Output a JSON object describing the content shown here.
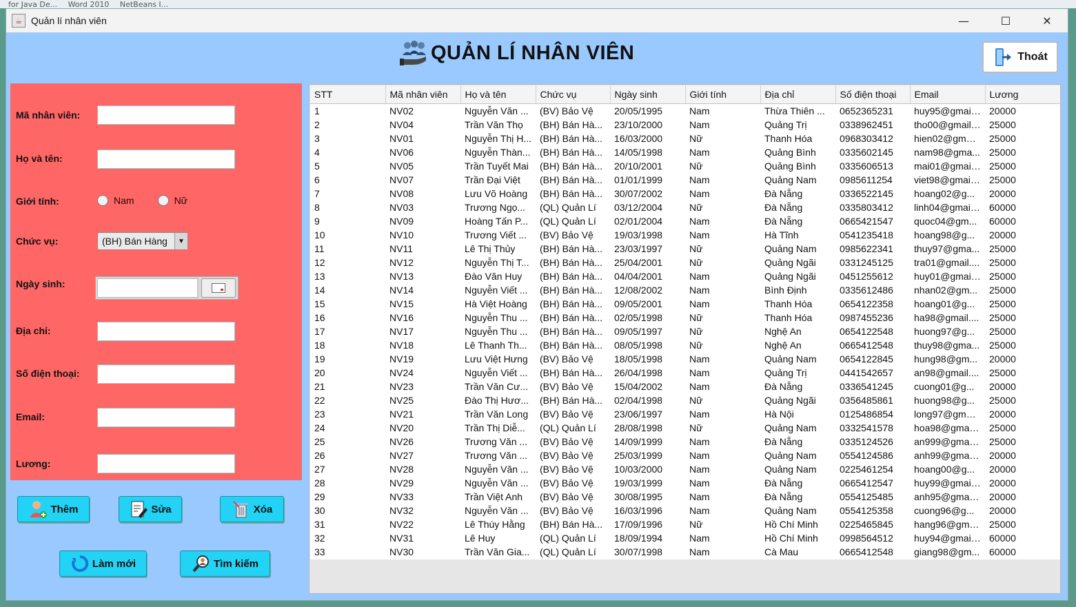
{
  "taskbar": [
    "for Java De...",
    "Word 2010",
    "NetBeans I..."
  ],
  "window": {
    "title": "Quản lí nhân viên",
    "controls": {
      "minimize": "—",
      "maximize": "☐",
      "close": "✕"
    }
  },
  "header": {
    "title": "QUẢN LÍ NHÂN VIÊN",
    "exit_label": "Thoát"
  },
  "form": {
    "labels": {
      "ma_nv": "Mã nhân viên:",
      "ho_ten": "Họ và tên:",
      "gioi_tinh": "Giới tính:",
      "chuc_vu": "Chức vụ:",
      "ngay_sinh": "Ngày sinh:",
      "dia_chi": "Địa chỉ:",
      "sdt": "Số điện thoại:",
      "email": "Email:",
      "luong": "Lương:"
    },
    "values": {
      "ma_nv": "",
      "ho_ten": "",
      "ngay_sinh": "",
      "dia_chi": "",
      "sdt": "",
      "email": "",
      "luong": ""
    },
    "gender_options": [
      "Nam",
      "Nữ"
    ],
    "chuc_vu_selected": "(BH) Bán Hàng"
  },
  "buttons": {
    "them": "Thêm",
    "sua": "Sửa",
    "xoa": "Xóa",
    "lam_moi": "Làm mới",
    "tim_kiem": "Tìm kiếm"
  },
  "colors": {
    "window_bg": "#99c9ff",
    "form_bg": "#ff6666",
    "button_bg": "#22d3f5"
  },
  "table": {
    "columns": [
      "STT",
      "Mã nhân viên",
      "Họ và tên",
      "Chức vụ",
      "Ngày sinh",
      "Giới tính",
      "Địa chỉ",
      "Số điện thoại",
      "Email",
      "Lương"
    ],
    "rows": [
      [
        "1",
        "NV02",
        "Nguyễn Văn ...",
        "(BV) Bảo Vệ",
        "20/05/1995",
        "Nam",
        "Thừa Thiên ...",
        "0652365231",
        "huy95@gmail....",
        "20000"
      ],
      [
        "2",
        "NV04",
        "Trần Văn Thọ",
        "(BH) Bán Hà...",
        "23/10/2000",
        "Nam",
        "Quảng Trị",
        "0338962451",
        "tho00@gmail....",
        "25000"
      ],
      [
        "3",
        "NV01",
        "Nguyễn Thị H...",
        "(BH) Bán Hà...",
        "16/03/2000",
        "Nữ",
        "Thanh Hóa",
        "0968303412",
        "hien02@gmai...",
        "25000"
      ],
      [
        "4",
        "NV06",
        "Nguyễn Thàn...",
        "(BH) Bán Hà...",
        "14/05/1998",
        "Nam",
        "Quảng Bình",
        "0335602145",
        "nam98@gma...",
        "25000"
      ],
      [
        "5",
        "NV05",
        "Trần Tuyết Mai",
        "(BH) Bán Hà...",
        "20/10/2001",
        "Nữ",
        "Quảng Bình",
        "0335606513",
        "mai01@gmail....",
        "25000"
      ],
      [
        "6",
        "NV07",
        "Trần Đại Việt",
        "(BH) Bán Hà...",
        "01/01/1999",
        "Nam",
        "Quảng Nam",
        "0985611254",
        "viet98@gmail....",
        "25000"
      ],
      [
        "7",
        "NV08",
        "Lưu Võ Hoàng",
        "(BH) Bán Hà...",
        "30/07/2002",
        "Nam",
        "Đà Nẵng",
        "0336522145",
        "hoang02@g...",
        "20000"
      ],
      [
        "8",
        "NV03",
        "Trương Ngọ...",
        "(QL) Quản Lí",
        "03/12/2004",
        "Nữ",
        "Đà Nẵng",
        "0335803412",
        "linh04@gmail....",
        "60000"
      ],
      [
        "9",
        "NV09",
        "Hoàng Tấn P...",
        "(QL) Quản Lí",
        "02/01/2004",
        "Nam",
        "Đà Nẵng",
        "0665421547",
        "quoc04@gm...",
        "60000"
      ],
      [
        "10",
        "NV10",
        "Trương Viết ...",
        "(BV) Bảo Vệ",
        "19/03/1998",
        "Nam",
        "Hà Tĩnh",
        "0541235418",
        "hoang98@g...",
        "20000"
      ],
      [
        "11",
        "NV11",
        "Lê Thị Thủy",
        "(BH) Bán Hà...",
        "23/03/1997",
        "Nữ",
        "Quảng Nam",
        "0985622341",
        "thuy97@gma...",
        "25000"
      ],
      [
        "12",
        "NV12",
        "Nguyễn Thị T...",
        "(BH) Bán Hà...",
        "25/04/2001",
        "Nữ",
        "Quảng Ngãi",
        "0331245125",
        "tra01@gmail....",
        "25000"
      ],
      [
        "13",
        "NV13",
        "Đào Văn Huy",
        "(BH) Bán Hà...",
        "04/04/2001",
        "Nam",
        "Quảng Ngãi",
        "0451255612",
        "huy01@gmail....",
        "25000"
      ],
      [
        "14",
        "NV14",
        "Nguyễn Viết ...",
        "(BH) Bán Hà...",
        "12/08/2002",
        "Nam",
        "Bình Định",
        "0335612486",
        "nhan02@gm...",
        "25000"
      ],
      [
        "15",
        "NV15",
        "Hà Việt Hoàng",
        "(BH) Bán Hà...",
        "09/05/2001",
        "Nam",
        "Thanh Hóa",
        "0654122358",
        "hoang01@g...",
        "25000"
      ],
      [
        "16",
        "NV16",
        "Nguyễn Thu ...",
        "(BH) Bán Hà...",
        "02/05/1998",
        "Nữ",
        "Thanh Hóa",
        "0987455236",
        "ha98@gmail....",
        "25000"
      ],
      [
        "17",
        "NV17",
        "Nguyễn Thu ...",
        "(BH) Bán Hà...",
        "09/05/1997",
        "Nữ",
        "Nghệ An",
        "0654122548",
        "huong97@g...",
        "25000"
      ],
      [
        "18",
        "NV18",
        "Lê Thanh Th...",
        "(BH) Bán Hà...",
        "08/05/1998",
        "Nữ",
        "Nghệ An",
        "0665412548",
        "thuy98@gma...",
        "25000"
      ],
      [
        "19",
        "NV19",
        "Lưu Việt Hưng",
        "(BV) Bảo Vệ",
        "18/05/1998",
        "Nam",
        "Quảng Nam",
        "0654122845",
        "hung98@gm...",
        "20000"
      ],
      [
        "20",
        "NV24",
        "Nguyễn Viết ...",
        "(BH) Bán Hà...",
        "26/04/1998",
        "Nam",
        "Quảng Trị",
        "0441542657",
        "an98@gmail....",
        "25000"
      ],
      [
        "21",
        "NV23",
        "Trần Văn Cư...",
        "(BV) Bảo Vệ",
        "15/04/2002",
        "Nam",
        "Đà Nẵng",
        "0336541245",
        "cuong01@g...",
        "20000"
      ],
      [
        "22",
        "NV25",
        "Đào Thị Hươ...",
        "(BH) Bán Hà...",
        "02/04/1998",
        "Nữ",
        "Quảng Ngãi",
        "0356485861",
        "huong98@g...",
        "25000"
      ],
      [
        "23",
        "NV21",
        "Trần Văn Long",
        "(BV) Bảo Vệ",
        "23/06/1997",
        "Nam",
        "Hà Nội",
        "0125486854",
        "long97@gmai...",
        "20000"
      ],
      [
        "24",
        "NV20",
        "Trần Thị Diễ...",
        "(QL) Quản Lí",
        "28/08/1998",
        "Nữ",
        "Quảng Nam",
        "0332541578",
        "hoa98@gmail....",
        "25000"
      ],
      [
        "25",
        "NV26",
        "Trương Văn ...",
        "(BV) Bảo Vệ",
        "14/09/1999",
        "Nam",
        "Đà Nẵng",
        "0335124526",
        "an999@gmail....",
        "25000"
      ],
      [
        "26",
        "NV27",
        "Trương Văn ...",
        "(BV) Bảo Vệ",
        "25/03/1999",
        "Nam",
        "Quảng Nam",
        "0554124586",
        "anh99@gmail....",
        "20000"
      ],
      [
        "27",
        "NV28",
        "Nguyễn Văn ...",
        "(BV) Bảo Vệ",
        "10/03/2000",
        "Nam",
        "Quảng Nam",
        "0225461254",
        "hoang00@g...",
        "20000"
      ],
      [
        "28",
        "NV29",
        "Nguyễn Văn ...",
        "(BV) Bảo Vệ",
        "19/03/1999",
        "Nam",
        "Đà Nẵng",
        "0665412547",
        "huy99@gmail....",
        "20000"
      ],
      [
        "29",
        "NV33",
        "Trần Việt Anh",
        "(BV) Bảo Vệ",
        "30/08/1995",
        "Nam",
        "Đà Nẵng",
        "0554125485",
        "anh95@gmail....",
        "20000"
      ],
      [
        "30",
        "NV32",
        "Nguyễn Văn ...",
        "(BV) Bảo Vệ",
        "16/03/1996",
        "Nam",
        "Quảng Nam",
        "0554125358",
        "cuong96@g...",
        "20000"
      ],
      [
        "31",
        "NV22",
        "Lê Thúy Hằng",
        "(BH) Bán Hà...",
        "17/09/1996",
        "Nữ",
        "Hồ Chí Minh",
        "0225465845",
        "hang96@gmai...",
        "25000"
      ],
      [
        "32",
        "NV31",
        "Lê Huy",
        "(QL) Quản Lí",
        "18/09/1994",
        "Nam",
        "Hồ Chí Minh",
        "0998564512",
        "huy94@gmail....",
        "60000"
      ],
      [
        "33",
        "NV30",
        "Trần Văn Gia...",
        "(QL) Quản Lí",
        "30/07/1998",
        "Nam",
        "Cà Mau",
        "0665412548",
        "giang98@gm...",
        "60000"
      ]
    ]
  }
}
